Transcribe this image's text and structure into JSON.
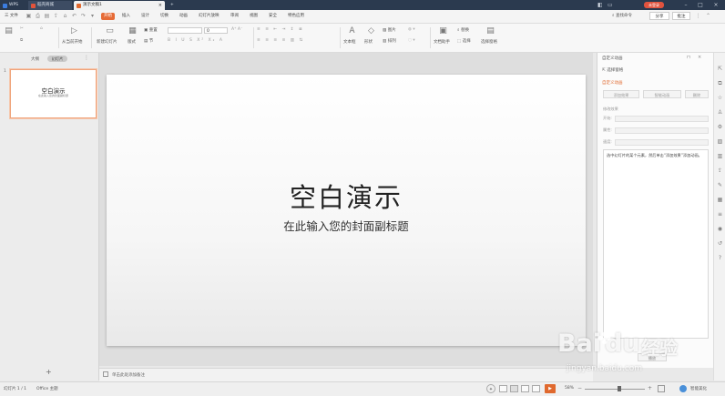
{
  "titlebar": {
    "tabs": [
      {
        "label": "WPS",
        "color": "#3b7de0"
      },
      {
        "label": "稻壳商城",
        "color": "#e2533b"
      },
      {
        "label": "演示文稿1",
        "color": "#e0692e"
      }
    ],
    "new_tab": "+",
    "badge": "未登录"
  },
  "menu": {
    "file": "三 文件",
    "items": [
      "开始",
      "插入",
      "设计",
      "切换",
      "动画",
      "幻灯片放映",
      "审阅",
      "视图",
      "安全",
      "特色应用"
    ],
    "search": "查找命令",
    "share": "分享",
    "comment": "批注"
  },
  "ribbon": {
    "play_from_current": "从当前开始",
    "new_slide": "新建幻灯片",
    "layout": "版式",
    "reset": "重置",
    "section": "节",
    "font_size": "0",
    "text_box": "文本框",
    "shapes": "形状",
    "arrange": "排列",
    "picture": "图片",
    "replace": "替换",
    "select": "选择",
    "doc_assistant": "文档助手",
    "select_pane": "选择窗格"
  },
  "left_panel": {
    "tab_outline": "大纲",
    "tab_slides": "幻灯片",
    "slide_number": "1",
    "thumb_title": "空白演示",
    "thumb_subtitle": "在此输入您的封面副标题",
    "add_slide": "+"
  },
  "slide": {
    "title": "空白演示",
    "subtitle": "在此输入您的封面副标题"
  },
  "notes": {
    "placeholder": "单击此处添加备注"
  },
  "right_pane": {
    "header": "自定义动画",
    "select_pane": "选择窗格",
    "section": "自定义动画",
    "add_effect": "添加效果",
    "smart_anim": "智能动画",
    "delete": "删除",
    "modify": "修改效果",
    "start_label": "开始:",
    "property_label": "属性:",
    "speed_label": "速度:",
    "hint": "选中幻灯片的某个元素，然后单击“添加效果”添加动画。",
    "play_button": "播放"
  },
  "statusbar": {
    "slide_info": "幻灯片 1 / 1",
    "theme": "Office 主题",
    "zoom": "58%",
    "smart_beautify": "智能美化"
  },
  "watermark": {
    "logo": "Bai",
    "logo2": "du",
    "jingyan": "经验",
    "url": "jingyan.baidu.com"
  }
}
